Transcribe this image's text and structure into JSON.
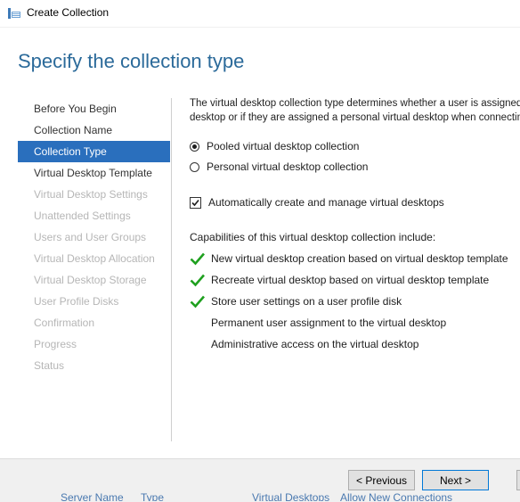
{
  "window": {
    "title": "Create Collection"
  },
  "header": {
    "title": "Specify the collection type"
  },
  "nav": {
    "items": [
      {
        "label": "Before You Begin",
        "state": "done"
      },
      {
        "label": "Collection Name",
        "state": "done"
      },
      {
        "label": "Collection Type",
        "state": "active"
      },
      {
        "label": "Virtual Desktop Template",
        "state": "next"
      },
      {
        "label": "Virtual Desktop Settings",
        "state": "disabled"
      },
      {
        "label": "Unattended Settings",
        "state": "disabled"
      },
      {
        "label": "Users and User Groups",
        "state": "disabled"
      },
      {
        "label": "Virtual Desktop Allocation",
        "state": "disabled"
      },
      {
        "label": "Virtual Desktop Storage",
        "state": "disabled"
      },
      {
        "label": "User Profile Disks",
        "state": "disabled"
      },
      {
        "label": "Confirmation",
        "state": "disabled"
      },
      {
        "label": "Progress",
        "state": "disabled"
      },
      {
        "label": "Status",
        "state": "disabled"
      }
    ]
  },
  "main": {
    "description_line1": "The virtual desktop collection type determines whether a user is assigned",
    "description_line2": "desktop or if they are assigned a personal virtual desktop when connecting",
    "options": {
      "pooled": {
        "label": "Pooled virtual desktop collection",
        "selected": true
      },
      "personal": {
        "label": "Personal virtual desktop collection",
        "selected": false
      }
    },
    "auto_create": {
      "label": "Automatically create and manage virtual desktops",
      "checked": true
    },
    "capabilities_heading": "Capabilities of this virtual desktop collection include:",
    "capabilities": [
      {
        "label": "New virtual desktop creation based on virtual desktop template",
        "checked": true
      },
      {
        "label": "Recreate virtual desktop based on virtual desktop template",
        "checked": true
      },
      {
        "label": "Store user settings on a user profile disk",
        "checked": true
      },
      {
        "label": "Permanent user assignment to the virtual desktop",
        "checked": false
      },
      {
        "label": "Administrative access on the virtual desktop",
        "checked": false
      }
    ]
  },
  "footer": {
    "previous_label": "< Previous",
    "next_label": "Next >"
  },
  "background": {
    "col1": "Server Name",
    "col2": "Type",
    "col3": "Virtual Desktops",
    "col4": "Allow New Connections"
  },
  "colors": {
    "accent": "#2a6fbd",
    "title": "#2b6a9a",
    "check": "#1fa01f"
  }
}
